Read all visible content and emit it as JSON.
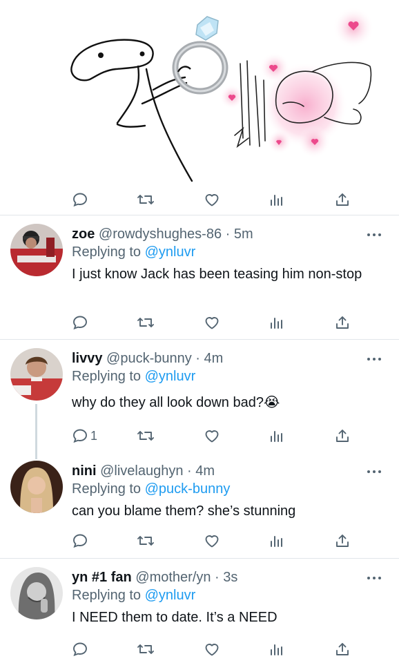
{
  "colors": {
    "accent": "#1d9bf0",
    "muted": "#536471",
    "text": "#0f1419",
    "divider": "#e1e6ea"
  },
  "media": {
    "description_icons": [
      "meme-drawing-ring",
      "meme-drawing-blushing"
    ]
  },
  "action_icons": [
    "reply-icon",
    "retweet-icon",
    "like-icon",
    "views-icon",
    "share-icon"
  ],
  "tweets": [
    {
      "name": "zoe",
      "handle": "@rowdyshughes-86",
      "sep": " · ",
      "time": "5m",
      "replying_label": "Replying to",
      "replying_to": "@ynluvr",
      "text": "I just know Jack has been teasing him non-stop",
      "reply_count": ""
    },
    {
      "name": "livvy",
      "handle": "@puck-bunny",
      "sep": " · ",
      "time": "4m",
      "replying_label": "Replying to",
      "replying_to": "@ynluvr",
      "text": "why do they all look down bad?😭",
      "reply_count": "1"
    },
    {
      "name": "nini",
      "handle": "@livelaughyn",
      "sep": " · ",
      "time": "4m",
      "replying_label": "Replying to",
      "replying_to": "@puck-bunny",
      "text": "can you blame them? she’s stunning",
      "reply_count": ""
    },
    {
      "name": "yn #1 fan",
      "handle": "@mother/yn",
      "sep": " · ",
      "time": "3s",
      "replying_label": "Replying to",
      "replying_to": "@ynluvr",
      "text": "I NEED them to date. It’s a NEED",
      "reply_count": ""
    }
  ]
}
